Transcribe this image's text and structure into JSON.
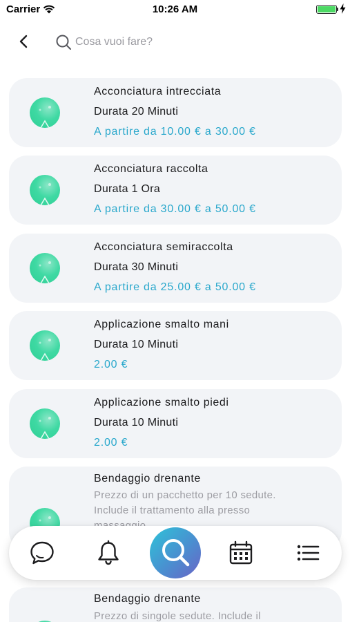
{
  "status_bar": {
    "carrier": "Carrier",
    "time": "10:26 AM",
    "battery_color": "#4cd964"
  },
  "header": {
    "back_icon": "chevron-left-icon",
    "search_placeholder": "Cosa vuoi fare?"
  },
  "services": [
    {
      "title": "Acconciatura intrecciata",
      "duration": "Durata 20 Minuti",
      "price": "A partire da 10.00 € a 30.00 €"
    },
    {
      "title": "Acconciatura raccolta",
      "duration": "Durata 1 Ora",
      "price": "A partire da 30.00 € a 50.00 €"
    },
    {
      "title": "Acconciatura semiraccolta",
      "duration": "Durata 30 Minuti",
      "price": "A partire da 25.00 € a 50.00 €"
    },
    {
      "title": "Applicazione smalto mani",
      "duration": "Durata 10 Minuti",
      "price": "2.00 €"
    },
    {
      "title": "Applicazione smalto piedi",
      "duration": "Durata 10 Minuti",
      "price": "2.00 €"
    },
    {
      "title": "Bendaggio drenante",
      "description": "Prezzo di un pacchetto per 10 sedute. Include il trattamento alla presso massaggio"
    },
    {
      "title": "Bendaggio drenante",
      "description": "Prezzo di singole sedute. Include il"
    }
  ],
  "tab_bar": {
    "items": [
      "chat-icon",
      "bell-icon",
      "search-icon",
      "calendar-icon",
      "list-icon"
    ],
    "active": "search-icon",
    "active_gradient": [
      "#2ec3d8",
      "#4a8fd0",
      "#6a63c6"
    ]
  },
  "colors": {
    "price": "#2aa8cc",
    "card_bg": "#f2f4f7",
    "description": "#9c9ca2"
  }
}
